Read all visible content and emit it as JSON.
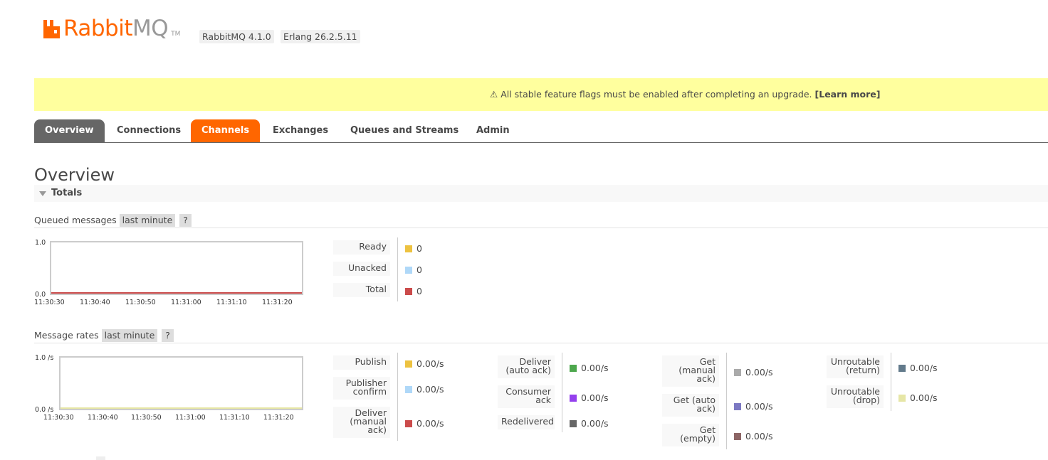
{
  "header": {
    "logo_primary": "Rabbit",
    "logo_secondary": "MQ",
    "logo_tm": "TM",
    "version_rabbit": "RabbitMQ 4.1.0",
    "version_erlang": "Erlang 26.2.5.11"
  },
  "banner": {
    "icon": "⚠",
    "message": "All stable feature flags must be enabled after completing an upgrade.",
    "link": "[Learn more]",
    "color": "#ffff9e"
  },
  "tabs": [
    {
      "label": "Overview",
      "state": "active"
    },
    {
      "label": "Connections",
      "state": "normal"
    },
    {
      "label": "Channels",
      "state": "highlight"
    },
    {
      "label": "Exchanges",
      "state": "normal"
    },
    {
      "label": "Queues and Streams",
      "state": "normal"
    },
    {
      "label": "Admin",
      "state": "normal"
    }
  ],
  "colors": {
    "accent": "#ff6600",
    "active_tab": "#666666"
  },
  "page": {
    "title": "Overview",
    "section": "Totals"
  },
  "queued": {
    "heading": "Queued messages",
    "range": "last minute",
    "help": "?",
    "legend": [
      {
        "label": "Ready",
        "value": "0",
        "color": "#edc240"
      },
      {
        "label": "Unacked",
        "value": "0",
        "color": "#afd8f8"
      },
      {
        "label": "Total",
        "value": "0",
        "color": "#cb4b4b"
      }
    ]
  },
  "rates": {
    "heading": "Message rates",
    "range": "last minute",
    "help": "?",
    "legend_col1": [
      {
        "label": "Publish",
        "value": "0.00/s",
        "color": "#edc240"
      },
      {
        "label": "Publisher confirm",
        "lines": [
          "Publisher",
          "confirm"
        ],
        "value": "0.00/s",
        "color": "#afd8f8"
      },
      {
        "label": "Deliver (manual ack)",
        "lines": [
          "Deliver",
          "(manual",
          "ack)"
        ],
        "value": "0.00/s",
        "color": "#cb4b4b"
      }
    ],
    "legend_col2": [
      {
        "label": "Deliver (auto ack)",
        "lines": [
          "Deliver",
          "(auto ack)"
        ],
        "value": "0.00/s",
        "color": "#4da74d"
      },
      {
        "label": "Consumer ack",
        "lines": [
          "Consumer",
          "ack"
        ],
        "value": "0.00/s",
        "color": "#9440ed"
      },
      {
        "label": "Redelivered",
        "value": "0.00/s",
        "color": "#666666"
      }
    ],
    "legend_col3": [
      {
        "label": "Get (manual ack)",
        "lines": [
          "Get",
          "(manual",
          "ack)"
        ],
        "value": "0.00/s",
        "color": "#aaaaaa"
      },
      {
        "label": "Get (auto ack)",
        "lines": [
          "Get (auto",
          "ack)"
        ],
        "value": "0.00/s",
        "color": "#7c79c3"
      },
      {
        "label": "Get (empty)",
        "lines": [
          "Get",
          "(empty)"
        ],
        "value": "0.00/s",
        "color": "#8d6666"
      }
    ],
    "legend_col4": [
      {
        "label": "Unroutable (return)",
        "lines": [
          "Unroutable",
          "(return)"
        ],
        "value": "0.00/s",
        "color": "#627a8b"
      },
      {
        "label": "Unroutable (drop)",
        "lines": [
          "Unroutable",
          "(drop)"
        ],
        "value": "0.00/s",
        "color": "#e6e6a6"
      }
    ]
  },
  "chart_data": [
    {
      "type": "line",
      "title": "Queued messages",
      "x": [
        "11:30:30",
        "11:30:40",
        "11:30:50",
        "11:31:00",
        "11:31:10",
        "11:31:20"
      ],
      "y_ticks": [
        "1.0",
        "0.0"
      ],
      "ylim": [
        0,
        1
      ],
      "grid": false,
      "series": [
        {
          "name": "Ready",
          "values": [
            0,
            0,
            0,
            0,
            0,
            0
          ],
          "color": "#edc240"
        },
        {
          "name": "Unacked",
          "values": [
            0,
            0,
            0,
            0,
            0,
            0
          ],
          "color": "#afd8f8"
        },
        {
          "name": "Total",
          "values": [
            0,
            0,
            0,
            0,
            0,
            0
          ],
          "color": "#cb4b4b"
        }
      ]
    },
    {
      "type": "line",
      "title": "Message rates",
      "x": [
        "11:30:30",
        "11:30:40",
        "11:30:50",
        "11:31:00",
        "11:31:10",
        "11:31:20"
      ],
      "y_ticks": [
        "1.0 /s",
        "0.0 /s"
      ],
      "ylim": [
        0,
        1
      ],
      "grid": false,
      "series": [
        {
          "name": "Publish",
          "values": [
            0,
            0,
            0,
            0,
            0,
            0
          ],
          "color": "#edc240"
        },
        {
          "name": "Unroutable (drop)",
          "values": [
            0,
            0,
            0,
            0,
            0,
            0
          ],
          "color": "#e6e6a6"
        }
      ]
    }
  ]
}
